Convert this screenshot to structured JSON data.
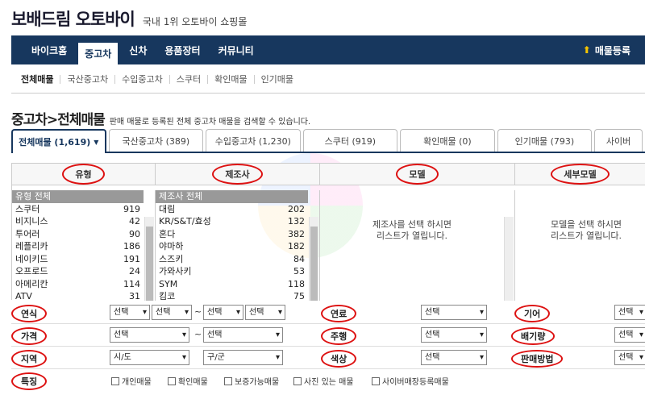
{
  "header": {
    "logo": "보배드림 오토바이",
    "tagline": "국내 1위 오토바이 쇼핑몰"
  },
  "nav": {
    "items": [
      {
        "label": "바이크홈"
      },
      {
        "label": "중고차"
      },
      {
        "label": "신차"
      },
      {
        "label": "용품장터"
      },
      {
        "label": "커뮤니티"
      }
    ],
    "register": "매물등록"
  },
  "subnav": {
    "items": [
      "전체매물",
      "국산중고차",
      "수입중고차",
      "스쿠터",
      "확인매물",
      "인기매물"
    ]
  },
  "page": {
    "title": "중고차>전체매물",
    "desc": "판매 매물로 등록된 전체 중고차 매물을 검색할 수 있습니다."
  },
  "tabs": [
    {
      "label": "전체매물 (1,619)"
    },
    {
      "label": "국산중고차 (389)"
    },
    {
      "label": "수입중고차 (1,230)"
    },
    {
      "label": "스쿠터 (919)"
    },
    {
      "label": "확인매물 (0)"
    },
    {
      "label": "인기매물 (793)"
    },
    {
      "label": "사이버"
    }
  ],
  "columns": {
    "type": "유형",
    "maker": "제조사",
    "model": "모델",
    "submodel": "세부모델"
  },
  "type_list": [
    {
      "name": "유형 전체",
      "count": ""
    },
    {
      "name": "스쿠터",
      "count": "919"
    },
    {
      "name": "비지니스",
      "count": "42"
    },
    {
      "name": "투어러",
      "count": "90"
    },
    {
      "name": "레플리카",
      "count": "186"
    },
    {
      "name": "네이키드",
      "count": "191"
    },
    {
      "name": "오프로드",
      "count": "24"
    },
    {
      "name": "아메리칸",
      "count": "114"
    },
    {
      "name": "ATV",
      "count": "31"
    }
  ],
  "maker_list": [
    {
      "name": "제조사 전체",
      "count": ""
    },
    {
      "name": "대림",
      "count": "202"
    },
    {
      "name": "KR/S&T/효성",
      "count": "132"
    },
    {
      "name": "혼다",
      "count": "382"
    },
    {
      "name": "야마하",
      "count": "182"
    },
    {
      "name": "스즈키",
      "count": "84"
    },
    {
      "name": "가와사키",
      "count": "53"
    },
    {
      "name": "SYM",
      "count": "118"
    },
    {
      "name": "킴코",
      "count": "75"
    }
  ],
  "model_placeholder": [
    "제조사를 선택 하시면",
    "리스트가 열립니다."
  ],
  "submodel_placeholder": [
    "모델을 선택 하시면",
    "리스트가 열립니다."
  ],
  "filters": {
    "year": "연식",
    "fuel": "연료",
    "gear": "기어",
    "price": "가격",
    "mileage": "주행",
    "displacement": "배기량",
    "region": "지역",
    "color": "색상",
    "sale_method": "판매방법",
    "features": "특징",
    "select": "선택",
    "sido": "시/도",
    "gugun": "구/군",
    "tilde": "~"
  },
  "features": [
    "개인매물",
    "확인매물",
    "보증가능매물",
    "사진 있는 매물",
    "사이버매장등록매물"
  ]
}
